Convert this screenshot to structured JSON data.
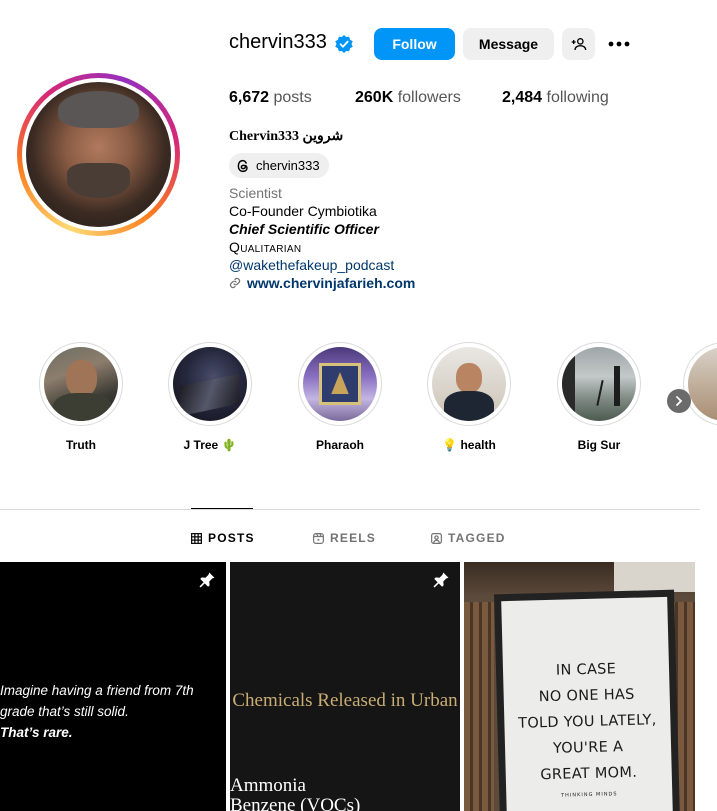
{
  "profile": {
    "username": "chervin333",
    "full_name": "Chervin333 شروین",
    "threads_handle": "chervin333",
    "category": "Scientist",
    "bio_lines": [
      "Co-Founder Cymbiotika",
      "Chief Scientific Officer",
      "Qualitarian"
    ],
    "mention": "@wakethefakeup_podcast",
    "website": "www.chervinjafarieh.com"
  },
  "actions": {
    "follow": "Follow",
    "message": "Message"
  },
  "stats": {
    "posts_count": "6,672",
    "posts_label": "posts",
    "followers_count": "260K",
    "followers_label": "followers",
    "following_count": "2,484",
    "following_label": "following"
  },
  "highlights": [
    {
      "label": "Truth"
    },
    {
      "label": "J Tree 🌵"
    },
    {
      "label": "Pharaoh"
    },
    {
      "label": "💡 health"
    },
    {
      "label": "Big Sur"
    }
  ],
  "tabs": [
    {
      "label": "POSTS",
      "active": true
    },
    {
      "label": "REELS",
      "active": false
    },
    {
      "label": "TAGGED",
      "active": false
    }
  ],
  "posts": {
    "p1": {
      "line1": "Imagine having a friend from 7th",
      "line2": "grade that’s still solid.",
      "line3": "That’s rare."
    },
    "p2": {
      "title": "Chemicals Released in Urban",
      "item1": "Ammonia",
      "item2": "Benzene (VOCs)"
    },
    "p3": {
      "line1": "IN CASE",
      "line2": "NO ONE HAS",
      "line3": "TOLD YOU LATELY,",
      "line4": "YOU'RE A",
      "line5": "GREAT MOM.",
      "footer": "THINKING MINDS"
    }
  },
  "colors": {
    "accent_blue": "#0095f6",
    "link_blue": "#00376b",
    "verified_blue": "#0095f6"
  }
}
